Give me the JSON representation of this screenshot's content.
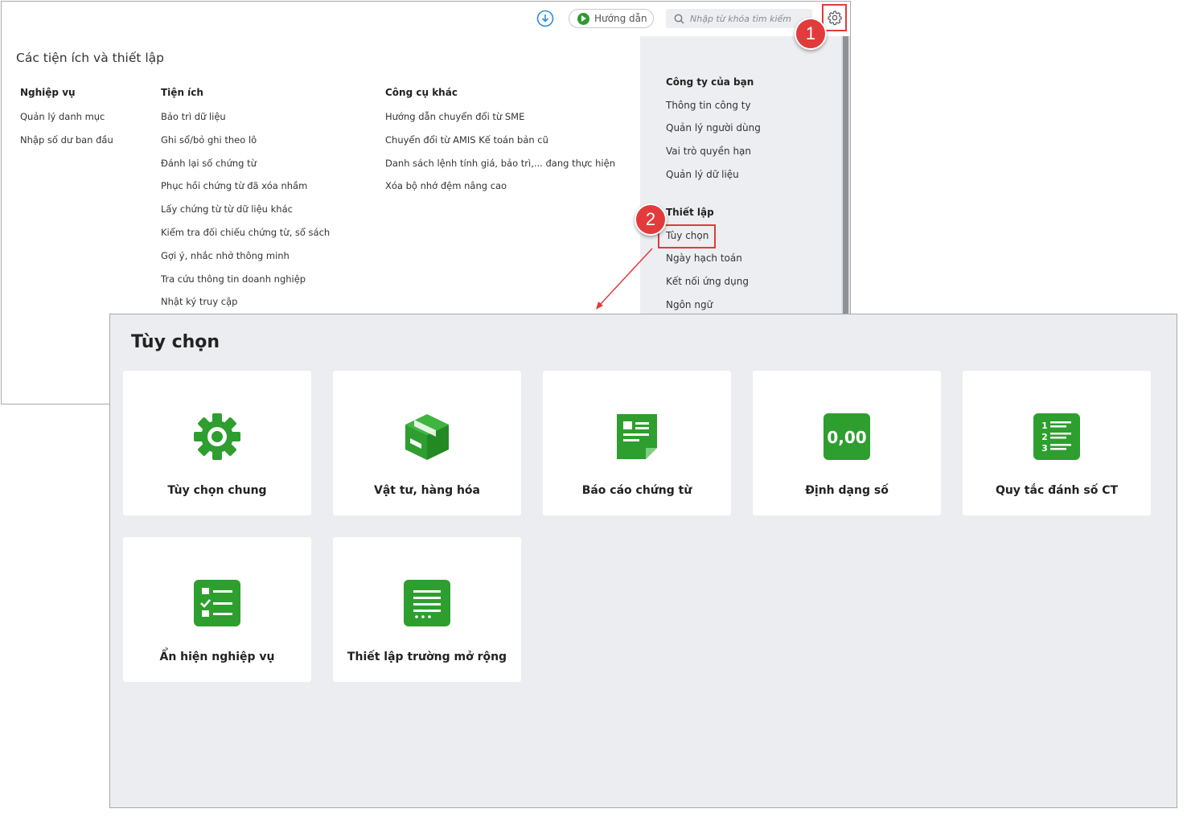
{
  "topbar": {
    "guide_label": "Hướng dẫn",
    "search_placeholder": "Nhập từ khóa tìm kiếm",
    "download_icon": "download-circle-icon",
    "settings_icon": "gear-icon"
  },
  "back_panel": {
    "title": "Các tiện ích và thiết lập",
    "columns": [
      {
        "heading": "Nghiệp vụ",
        "items": [
          "Quản lý danh mục",
          "Nhập số dư ban đầu"
        ]
      },
      {
        "heading": "Tiện ích",
        "items": [
          "Bảo trì dữ liệu",
          "Ghi sổ/bỏ ghi theo lô",
          "Đánh lại số chứng từ",
          "Phục hồi chứng từ đã xóa nhầm",
          "Lấy chứng từ từ dữ liệu khác",
          "Kiểm tra đối chiếu chứng từ, sổ sách",
          "Gợi ý, nhắc nhở thông minh",
          "Tra cứu thông tin doanh nghiệp",
          "Nhật ký truy cập"
        ]
      },
      {
        "heading": "Công cụ khác",
        "items": [
          "Hướng dẫn chuyển đổi từ SME",
          "Chuyển đổi từ AMIS Kế toán bản cũ",
          "Danh sách lệnh tính giá, bảo trì,... đang thực hiện",
          "Xóa bộ nhớ đệm nâng cao"
        ]
      }
    ],
    "right_menu": {
      "company_heading": "Công ty của bạn",
      "company_items": [
        "Thông tin công ty",
        "Quản lý người dùng",
        "Vai trò quyền hạn",
        "Quản lý dữ liệu"
      ],
      "settings_heading": "Thiết lập",
      "settings_items": [
        "Tùy chọn",
        "Ngày hạch toán",
        "Kết nối ứng dụng",
        "Ngôn ngữ"
      ]
    }
  },
  "badges": [
    "1",
    "2"
  ],
  "front_panel": {
    "title": "Tùy chọn",
    "tiles": [
      {
        "label": "Tùy chọn chung",
        "icon": "gear-icon"
      },
      {
        "label": "Vật tư, hàng hóa",
        "icon": "box-icon"
      },
      {
        "label": "Báo cáo chứng từ",
        "icon": "document-report-icon"
      },
      {
        "label": "Định dạng số",
        "icon": "number-format-icon",
        "icon_text": "0,00"
      },
      {
        "label": "Quy tắc đánh số CT",
        "icon": "numbered-list-icon"
      },
      {
        "label": "Ẩn hiện nghiệp vụ",
        "icon": "checklist-icon"
      },
      {
        "label": "Thiết lập trường mở rộng",
        "icon": "lines-more-icon"
      }
    ]
  },
  "colors": {
    "accent_green": "#2e9e2e",
    "highlight_red": "#e03b3b"
  }
}
